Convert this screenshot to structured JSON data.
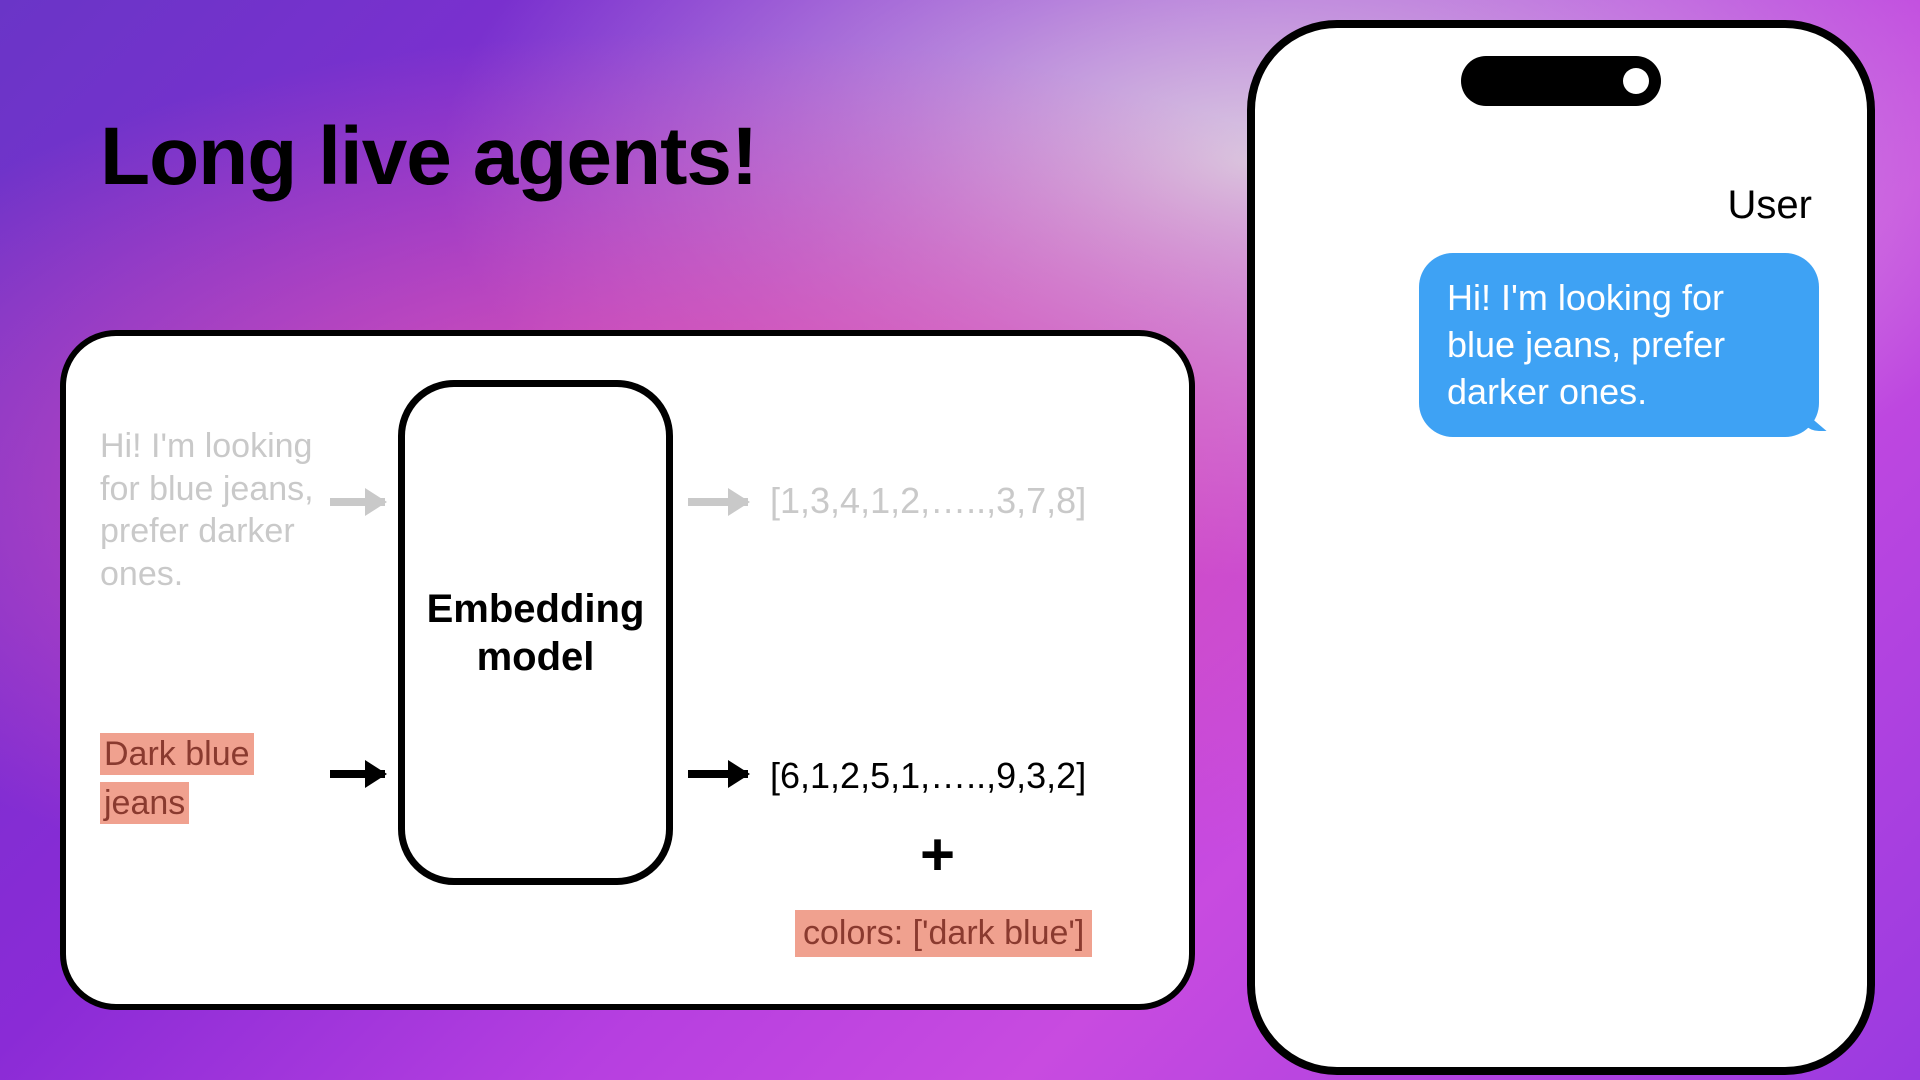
{
  "title": "Long live agents!",
  "diagram": {
    "model_label": "Embedding model",
    "input_faded": "Hi! I'm looking for blue jeans, prefer darker ones.",
    "input_highlight_line1": "Dark blue",
    "input_highlight_line2": "jeans",
    "output_vector_faded": "[1,3,4,1,2,…..,3,7,8]",
    "output_vector_dark": "[6,1,2,5,1,…..,9,3,2]",
    "plus_symbol": "+",
    "colors_filter": "colors: ['dark blue']"
  },
  "phone": {
    "user_label": "User",
    "message": "Hi! I'm looking for blue jeans, prefer darker ones."
  },
  "colors": {
    "highlight_bg": "#f0a18f",
    "highlight_text": "#8a3a2f",
    "bubble_bg": "#3ea2f4",
    "faded": "#c9c9c9"
  }
}
